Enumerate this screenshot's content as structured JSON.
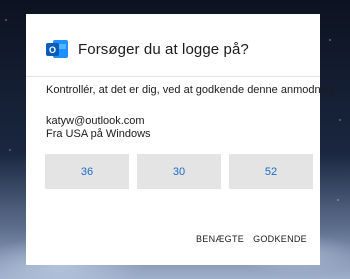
{
  "dialog": {
    "app_icon_letter": "O",
    "title": "Forsøger du at logge på?",
    "instruction": "Kontrollér, at det er dig, ved at godkende denne anmodning",
    "account_email": "katyw@outlook.com",
    "account_location": "Fra USA på Windows",
    "codes": [
      "36",
      "30",
      "52"
    ],
    "deny_label": "BENÆGTE",
    "approve_label": "GODKENDE"
  },
  "colors": {
    "code_text": "#1a6ec2",
    "code_bg": "#e4e4e4",
    "outlook_blue": "#0a5cb8"
  }
}
